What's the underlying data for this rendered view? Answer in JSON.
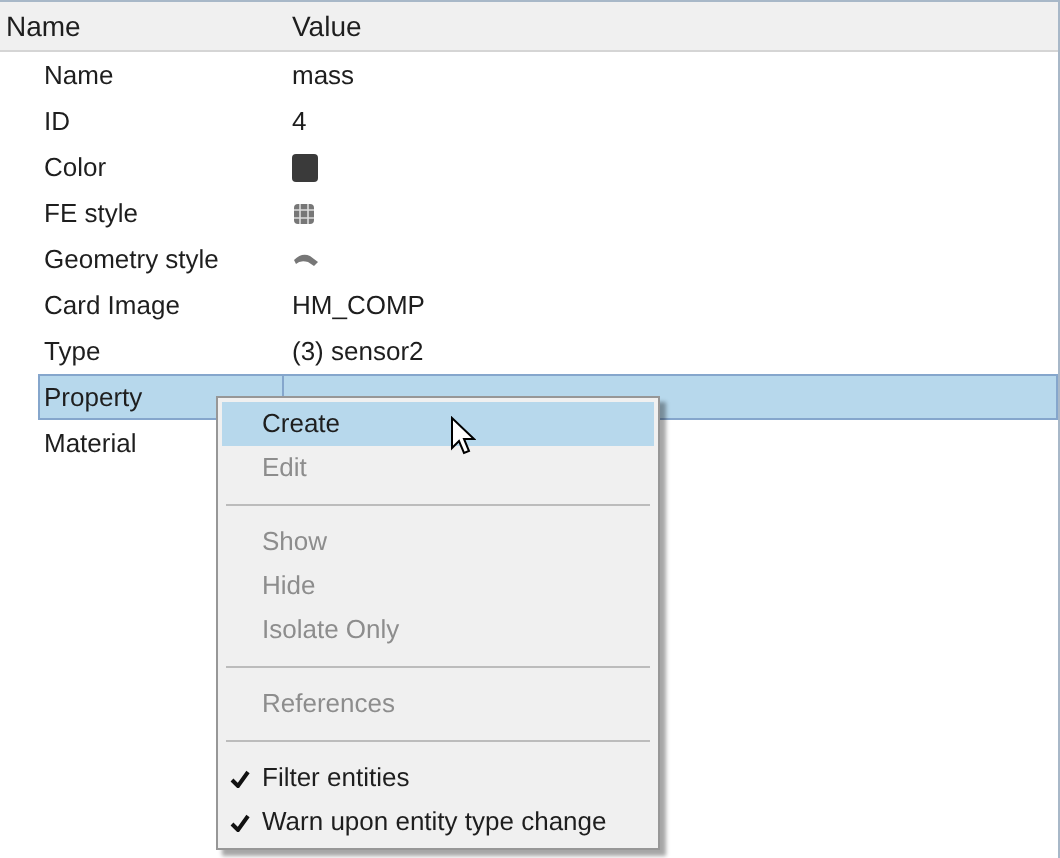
{
  "columns": [
    "Name",
    "Value"
  ],
  "rows": [
    {
      "name": "Name",
      "kind": "text",
      "value": "mass",
      "selected": false
    },
    {
      "name": "ID",
      "kind": "text",
      "value": "4",
      "selected": false
    },
    {
      "name": "Color",
      "kind": "swatch",
      "color": "#3a3a3a",
      "selected": false
    },
    {
      "name": "FE style",
      "kind": "fe-style",
      "selected": false
    },
    {
      "name": "Geometry style",
      "kind": "geometry-style",
      "selected": false
    },
    {
      "name": "Card Image",
      "kind": "text",
      "value": "HM_COMP",
      "selected": false
    },
    {
      "name": "Type",
      "kind": "text",
      "value": "(3) sensor2",
      "selected": false
    },
    {
      "name": "Property",
      "kind": "text",
      "selected": true
    },
    {
      "name": "Material",
      "kind": "text",
      "selected": false
    }
  ],
  "context_menu": [
    {
      "kind": "item",
      "label": "Create",
      "disabled": false,
      "selected": true,
      "checked": false
    },
    {
      "kind": "item",
      "label": "Edit",
      "disabled": true,
      "selected": false,
      "checked": false
    },
    {
      "kind": "separator"
    },
    {
      "kind": "item",
      "label": "Show",
      "disabled": true,
      "selected": false,
      "checked": false
    },
    {
      "kind": "item",
      "label": "Hide",
      "disabled": true,
      "selected": false,
      "checked": false
    },
    {
      "kind": "item",
      "label": "Isolate Only",
      "disabled": true,
      "selected": false,
      "checked": false
    },
    {
      "kind": "separator"
    },
    {
      "kind": "item",
      "label": "References",
      "disabled": true,
      "selected": false,
      "checked": false
    },
    {
      "kind": "separator"
    },
    {
      "kind": "item",
      "label": "Filter entities",
      "disabled": false,
      "selected": false,
      "checked": true
    },
    {
      "kind": "item",
      "label": "Warn upon entity type change",
      "disabled": false,
      "selected": false,
      "checked": true
    }
  ]
}
